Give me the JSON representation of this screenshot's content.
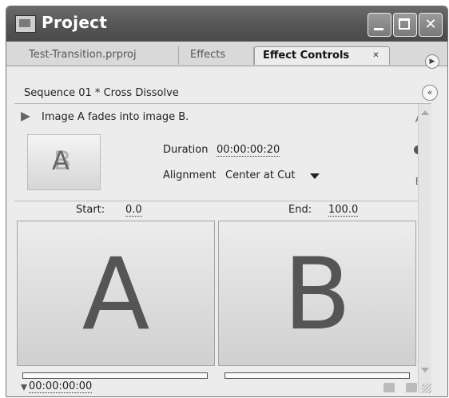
{
  "window": {
    "title": "Project"
  },
  "tabs": [
    {
      "label": "Test-Transition.prproj",
      "active": false
    },
    {
      "label": "Effects",
      "active": false
    },
    {
      "label": "Effect Controls",
      "active": true
    }
  ],
  "sequence": {
    "title": "Sequence 01 * Cross Dissolve"
  },
  "effect": {
    "description": "Image A fades into image B.",
    "side_label_a": "A",
    "side_label_b": "B",
    "thumb_a": "A",
    "thumb_b": "B",
    "duration_label": "Duration",
    "duration_value": "00:00:00:20",
    "alignment_label": "Alignment",
    "alignment_value": "Center at Cut",
    "start_label": "Start:",
    "start_value": "0.0",
    "end_label": "End:",
    "end_value": "100.0",
    "preview_a": "A",
    "preview_b": "B",
    "timecode": "00:00:00:00"
  },
  "icons": {
    "play": "play-icon",
    "swap": "swap-icon",
    "dropdown": "chevron-down-icon",
    "collapse": "double-chevron-left-icon",
    "panel_menu": "panel-menu-icon"
  }
}
